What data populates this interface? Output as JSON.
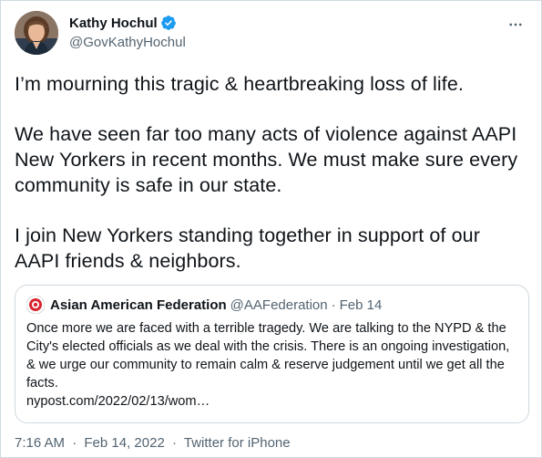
{
  "author": {
    "display_name": "Kathy Hochul",
    "handle": "@GovKathyHochul",
    "verified": true,
    "avatar_icon": "person-portrait-avatar"
  },
  "tweet": {
    "paragraphs": [
      "I’m mourning this tragic & heartbreaking loss of life.",
      "We have seen far too many acts of violence against AAPI New Yorkers in recent months. We must make sure every community is safe in our state.",
      "I join New Yorkers standing together in support of our AAPI friends & neighbors."
    ],
    "more_icon": "more-horizontal-icon"
  },
  "quote": {
    "display_name": "Asian American Federation",
    "handle": "@AAFederation",
    "separator": "·",
    "date": "Feb 14",
    "text": "Once more we are faced with a terrible tragedy. We are talking to the NYPD & the City's elected officials as we deal with the crisis. There is an ongoing investigation, & we urge our community to remain calm & reserve judgement until we get all the facts.",
    "link": "nypost.com/2022/02/13/wom…"
  },
  "meta": {
    "time": "7:16 AM",
    "separator_1": "·",
    "date": "Feb 14, 2022",
    "separator_2": "·",
    "source": "Twitter for iPhone"
  },
  "colors": {
    "text_primary": "#0f1419",
    "text_secondary": "#536471",
    "border": "#cfd9de",
    "verified_blue": "#1d9bf0",
    "quote_avatar_red": "#d7262f"
  }
}
